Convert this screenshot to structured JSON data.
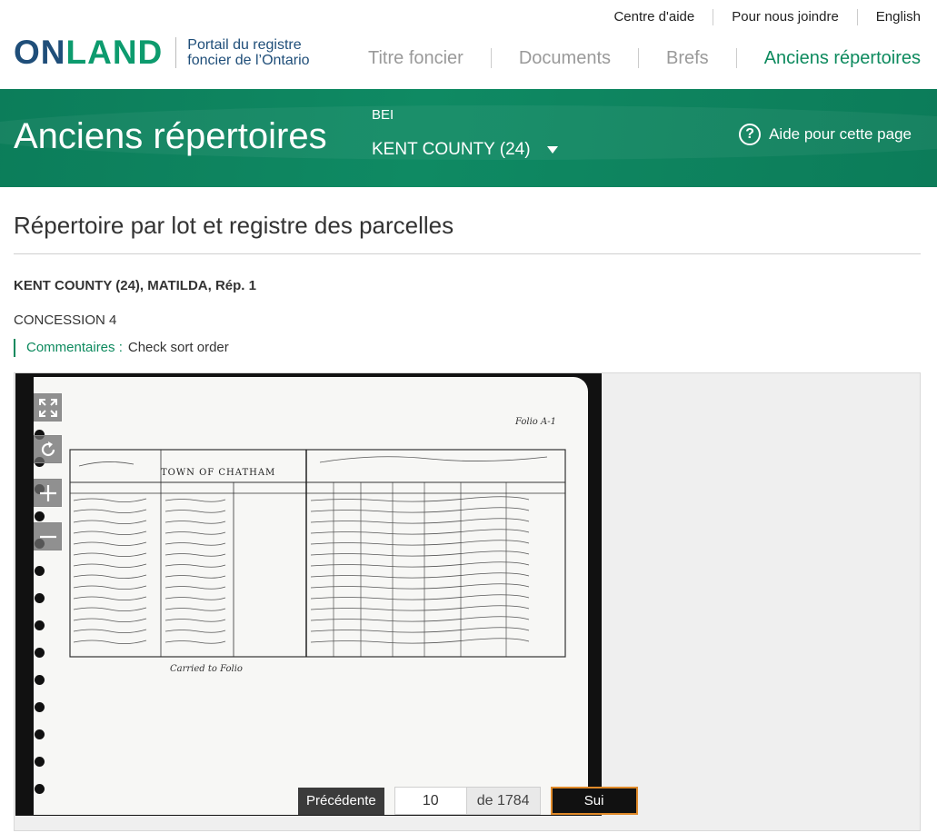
{
  "utility_nav": {
    "help_center": "Centre d'aide",
    "contact": "Pour nous joindre",
    "language": "English"
  },
  "logo": {
    "word_a": "ON",
    "word_b": "LAND",
    "tagline_line1": "Portail du registre",
    "tagline_line2": "foncier de l’Ontario"
  },
  "main_nav": {
    "items": [
      "Titre foncier",
      "Documents",
      "Brefs",
      "Anciens répertoires"
    ],
    "active": "Anciens répertoires"
  },
  "banner": {
    "title": "Anciens répertoires",
    "office_label": "BEI",
    "office_value": "KENT COUNTY (24)",
    "help_label": "Aide pour cette page"
  },
  "content": {
    "page_title": "Répertoire par lot et registre des parcelles",
    "location": "KENT COUNTY (24), MATILDA, Rép. 1",
    "concession": "CONCESSION 4",
    "comments_label": "Commentaires :",
    "comments_value": "Check sort order"
  },
  "scan_text": {
    "folio": "Folio",
    "folio_number": "A-1",
    "header": "TOWN OF CHATHAM",
    "carried": "Carried to Folio"
  },
  "viewer": {
    "controls": [
      "fullscreen-icon",
      "rotate-icon",
      "zoom-in-icon",
      "zoom-out-icon"
    ],
    "prev_label": "Précédente",
    "page_value": "10",
    "total_label": "de 1784",
    "next_label": "Sui"
  },
  "colors": {
    "brand_green": "#0d8a5e",
    "brand_blue": "#1f4e79",
    "next_border": "#e08a2a"
  }
}
